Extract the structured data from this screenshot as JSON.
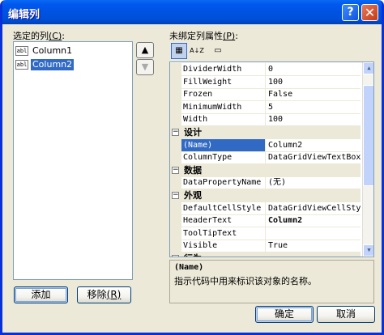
{
  "window": {
    "title": "编辑列",
    "help_button": "?",
    "close_button": "✕"
  },
  "selected_columns": {
    "label": "选定的列",
    "accel": "(C)",
    "label_suffix": ":",
    "items": [
      {
        "icon": "abl",
        "label": "Column1",
        "selected": false
      },
      {
        "icon": "abl",
        "label": "Column2",
        "selected": true
      }
    ]
  },
  "move_up": "▲",
  "move_down": "▼",
  "add_button": {
    "label": "添加",
    "accel": ""
  },
  "remove_button": {
    "label": "移除",
    "accel": "(R)"
  },
  "properties": {
    "label": "未绑定列属性",
    "accel": "(P)",
    "label_suffix": ":",
    "toolbar": {
      "categorized": "▦",
      "alphabetical": "A↓Z",
      "pages": "▭"
    },
    "rows": [
      {
        "kind": "prop",
        "name": "DividerWidth",
        "value": "0"
      },
      {
        "kind": "prop",
        "name": "FillWeight",
        "value": "100"
      },
      {
        "kind": "prop",
        "name": "Frozen",
        "value": "False"
      },
      {
        "kind": "prop",
        "name": "MinimumWidth",
        "value": "5"
      },
      {
        "kind": "prop",
        "name": "Width",
        "value": "100"
      },
      {
        "kind": "cat",
        "name": "设计",
        "toggle": "−"
      },
      {
        "kind": "prop",
        "name": "(Name)",
        "value": "Column2",
        "selected": true
      },
      {
        "kind": "prop",
        "name": "ColumnType",
        "value": "DataGridViewTextBoxCo"
      },
      {
        "kind": "cat",
        "name": "数据",
        "toggle": "−"
      },
      {
        "kind": "prop",
        "name": "DataPropertyName",
        "value": "(无)"
      },
      {
        "kind": "cat",
        "name": "外观",
        "toggle": "−"
      },
      {
        "kind": "prop",
        "name": "DefaultCellStyle",
        "value": "DataGridViewCellStyle"
      },
      {
        "kind": "prop",
        "name": "HeaderText",
        "value": "Column2",
        "bold": true
      },
      {
        "kind": "prop",
        "name": "ToolTipText",
        "value": ""
      },
      {
        "kind": "prop",
        "name": "Visible",
        "value": "True"
      },
      {
        "kind": "cat",
        "name": "行为",
        "toggle": "−"
      }
    ],
    "description": {
      "title": "(Name)",
      "text": "指示代码中用来标识该对象的名称。"
    }
  },
  "ok_button": {
    "label": "确定"
  },
  "cancel_button": {
    "label": "取消"
  },
  "colors": {
    "title_bar": "#0054e3",
    "selection": "#316ac5",
    "dialog_bg": "#ece9d8"
  }
}
